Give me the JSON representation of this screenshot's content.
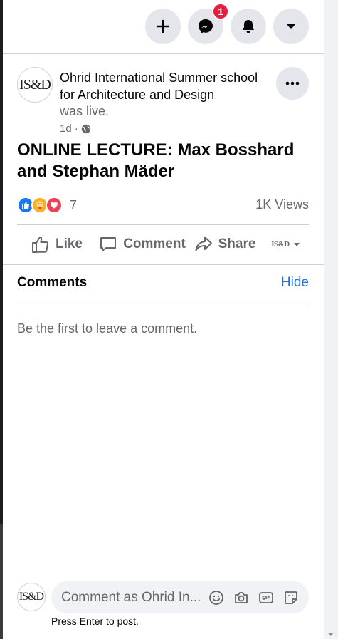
{
  "topbar": {
    "create_icon": "plus-icon",
    "messenger_icon": "messenger-icon",
    "messenger_badge": "1",
    "notifications_icon": "bell-icon",
    "account_icon": "caret-down-icon"
  },
  "post": {
    "author_name": "Ohrid International Summer school for Architecture and Design",
    "status": "was live.",
    "time": "1d",
    "separator": "·",
    "privacy_icon": "globe-icon",
    "avatar_text": "IS&D",
    "title": "ONLINE LECTURE: Max Bosshard and Stephan Mäder",
    "reaction_count": "7",
    "views": "1K Views"
  },
  "actions": {
    "like": "Like",
    "comment": "Comment",
    "share": "Share",
    "profile_avatar_text": "IS&D"
  },
  "comments": {
    "title": "Comments",
    "hide": "Hide",
    "empty": "Be the first to leave a comment."
  },
  "composer": {
    "avatar_text": "IS&D",
    "placeholder": "Comment as Ohrid In...",
    "hint": "Press Enter to post."
  },
  "colors": {
    "accent": "#216fdb",
    "badge": "#e41e3f",
    "like": "#1877f2",
    "love": "#f33e58",
    "care": "#f7b125"
  }
}
